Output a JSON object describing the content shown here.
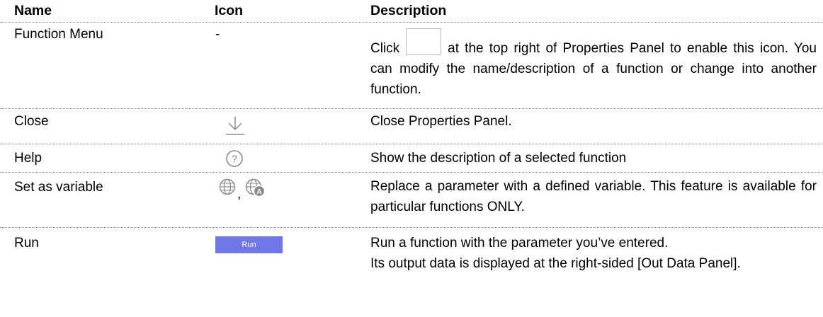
{
  "header": {
    "name": "Name",
    "icon": "Icon",
    "description": "Description"
  },
  "rows": [
    {
      "name": "Function Menu",
      "icon_text": "-",
      "desc_before": "Click",
      "desc_after": "at the top right of Properties Panel to enable this icon. You can modify the name/description of a function or change into another function.",
      "inline_icon": "kebab-menu-icon"
    },
    {
      "name": "Close",
      "icon": "close-arrow-down-icon",
      "description": "Close Properties Panel."
    },
    {
      "name": "Help",
      "icon": "help-question-icon",
      "description": "Show the description of a selected function"
    },
    {
      "name": "Set as variable",
      "icons": [
        "globe-icon",
        "globe-variable-icon"
      ],
      "separator": ",",
      "description": "Replace a parameter with a defined variable. This feature is available for particular functions ONLY."
    },
    {
      "name": "Run",
      "button_label": "Run",
      "description_line1": "Run a function with the parameter you’ve entered.",
      "description_line2": "Its output data is displayed at the right-sided [Out Data Panel]."
    }
  ],
  "colors": {
    "run_button": "#7177e6",
    "icon_gray": "#8a8a8a",
    "row_border": "#8c8c8c"
  }
}
